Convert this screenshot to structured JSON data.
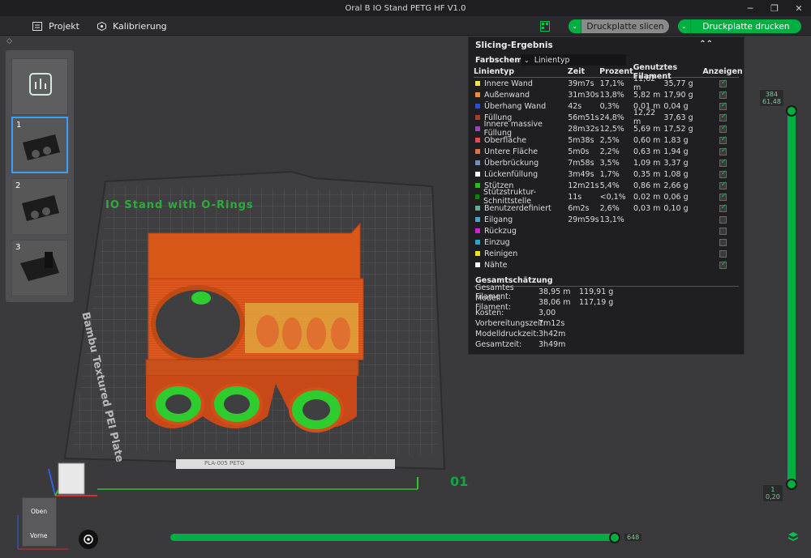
{
  "window": {
    "title": "Oral B IO Stand PETG HF V1.0"
  },
  "menu": {
    "project_label": "Projekt",
    "calibration_label": "Kalibrierung"
  },
  "actions": {
    "slice_label": "Druckplatte slicen",
    "print_label": "Druckplatte drucken"
  },
  "thumbnails": [
    {
      "num": ""
    },
    {
      "num": "1"
    },
    {
      "num": "2"
    },
    {
      "num": "3"
    }
  ],
  "plate": {
    "object_name": "IO Stand with O-Rings",
    "plate_label": "Bambu Textured PEI Plate",
    "plate_number": "01",
    "bottom_bar_text": "PLA-005 PETG"
  },
  "results": {
    "title": "Slicing-Ergebnis",
    "schema_label": "Farbschema",
    "schema_value": "Linientyp",
    "headers": {
      "type": "Linientyp",
      "time": "Zeit",
      "percent": "Prozent",
      "filament": "Genutztes Filament",
      "show": "Anzeigen"
    },
    "rows": [
      {
        "name": "Innere Wand",
        "color": "#f5e24e",
        "time": "39m7s",
        "pct": "17,1%",
        "m": "11,62 m",
        "g": "35,77 g",
        "show": true
      },
      {
        "name": "Außenwand",
        "color": "#f08c3c",
        "time": "31m30s",
        "pct": "13,8%",
        "m": "5,82 m",
        "g": "17,90 g",
        "show": true
      },
      {
        "name": "Überhang Wand",
        "color": "#2a4fd8",
        "time": "42s",
        "pct": "0,3%",
        "m": "0,01 m",
        "g": "0,04 g",
        "show": true
      },
      {
        "name": "Füllung",
        "color": "#b03a2e",
        "time": "56m51s",
        "pct": "24,8%",
        "m": "12,22 m",
        "g": "37,63 g",
        "show": true
      },
      {
        "name": "Innere massive Füllung",
        "color": "#a040c8",
        "time": "28m32s",
        "pct": "12,5%",
        "m": "5,69 m",
        "g": "17,52 g",
        "show": true
      },
      {
        "name": "Oberfläche",
        "color": "#e84848",
        "time": "5m38s",
        "pct": "2,5%",
        "m": "0,60 m",
        "g": "1,83 g",
        "show": true
      },
      {
        "name": "Untere Fläche",
        "color": "#e07040",
        "time": "5m0s",
        "pct": "2,2%",
        "m": "0,63 m",
        "g": "1,94 g",
        "show": true
      },
      {
        "name": "Überbrückung",
        "color": "#7090b8",
        "time": "7m58s",
        "pct": "3,5%",
        "m": "1,09 m",
        "g": "3,37 g",
        "show": true
      },
      {
        "name": "Lückenfüllung",
        "color": "#ffffff",
        "time": "3m49s",
        "pct": "1,7%",
        "m": "0,35 m",
        "g": "1,08 g",
        "show": true
      },
      {
        "name": "Stützen",
        "color": "#20c020",
        "time": "12m21s",
        "pct": "5,4%",
        "m": "0,86 m",
        "g": "2,66 g",
        "show": true
      },
      {
        "name": "Stützstruktur-Schnittstelle",
        "color": "#108010",
        "time": "11s",
        "pct": "<0,1%",
        "m": "0,02 m",
        "g": "0,06 g",
        "show": true
      },
      {
        "name": "Benutzerdefiniert",
        "color": "#60b090",
        "time": "6m2s",
        "pct": "2,6%",
        "m": "0,03 m",
        "g": "0,10 g",
        "show": true
      },
      {
        "name": "Eilgang",
        "color": "#40a8c8",
        "time": "29m59s",
        "pct": "13,1%",
        "m": "",
        "g": "",
        "show": false
      },
      {
        "name": "Rückzug",
        "color": "#d020d0",
        "time": "",
        "pct": "",
        "m": "",
        "g": "",
        "show": false
      },
      {
        "name": "Einzug",
        "color": "#20a8d0",
        "time": "",
        "pct": "",
        "m": "",
        "g": "",
        "show": false
      },
      {
        "name": "Reinigen",
        "color": "#f0e020",
        "time": "",
        "pct": "",
        "m": "",
        "g": "",
        "show": false
      },
      {
        "name": "Nähte",
        "color": "#f8f8f8",
        "time": "",
        "pct": "",
        "m": "",
        "g": "",
        "show": true
      }
    ],
    "estimate": {
      "title": "Gesamtschätzung",
      "rows": [
        {
          "k": "Gesamtes Filament:",
          "v1": "38,95 m",
          "v2": "119,91 g"
        },
        {
          "k": "Modell Filament:",
          "v1": "38,06 m",
          "v2": "117,19 g"
        },
        {
          "k": "Kosten:",
          "v1": "3,00",
          "v2": ""
        },
        {
          "k": "Vorbereitungszeit:",
          "v1": "7m12s",
          "v2": ""
        },
        {
          "k": "Modelldruckzeit:",
          "v1": "3h42m",
          "v2": ""
        },
        {
          "k": "Gesamtzeit:",
          "v1": "3h49m",
          "v2": ""
        }
      ]
    }
  },
  "layer_slider": {
    "top_layer": "384",
    "top_height": "61,48",
    "bottom_layer": "1",
    "bottom_height": "0,20"
  },
  "move_slider": {
    "value": "648"
  },
  "viewcube": {
    "top_label": "Oben",
    "front_label": "Vorne"
  },
  "colors": {
    "accent": "#00ae42",
    "selection": "#39a0ff",
    "object_orange": "#e0601a"
  }
}
